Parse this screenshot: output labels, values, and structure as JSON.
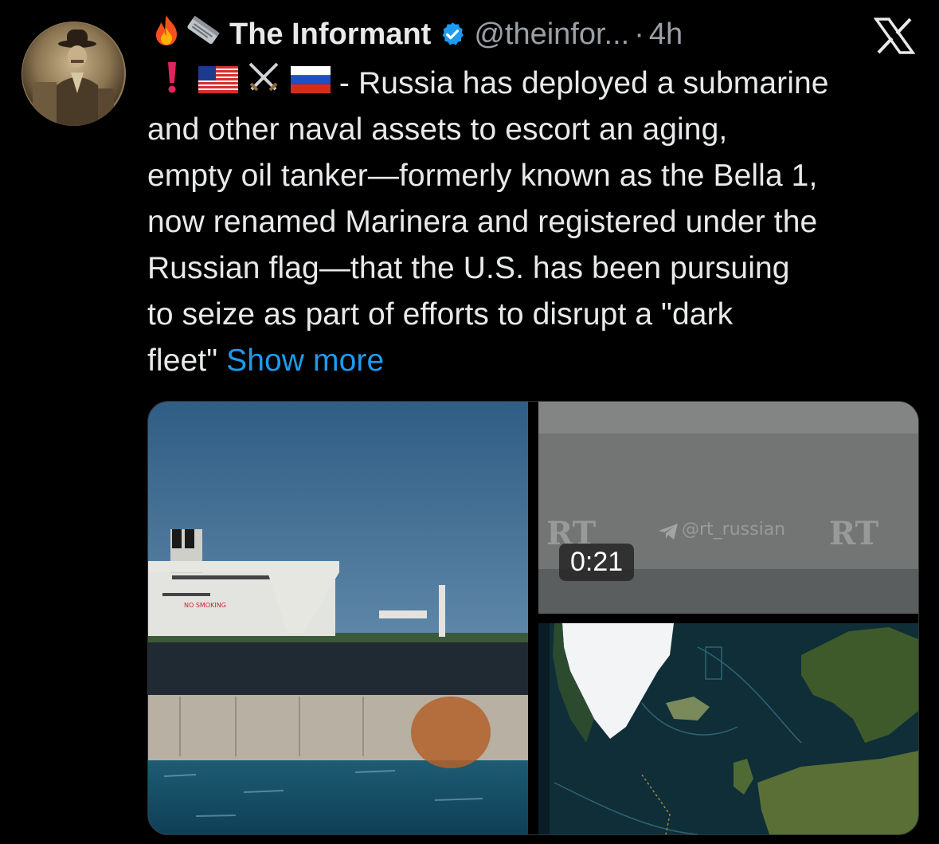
{
  "author": {
    "display_name": "The Informant",
    "handle": "@theinfor...",
    "separator": "·",
    "time": "4h",
    "emojis": [
      "fire-emoji",
      "newspaper-emoji"
    ],
    "verified_color": "#1d9bf0"
  },
  "tweet": {
    "lead_emojis": [
      "red-exclamation-emoji",
      "us-flag-emoji",
      "crossed-swords-emoji",
      "russia-flag-emoji"
    ],
    "lines": [
      " - Russia has deployed a submarine",
      "and other naval assets to escort an aging,",
      "empty oil tanker—formerly known as the Bella 1,",
      "now renamed Marinera and registered under the",
      "Russian flag—that the U.S. has been pursuing",
      "to seize as part of efforts to disrupt a \"dark",
      "fleet\""
    ],
    "show_more": "Show more"
  },
  "media": {
    "video": {
      "duration": "0:21",
      "watermark_left": "RT",
      "watermark_handle": "@rt_russian",
      "watermark_right": "RT"
    },
    "ship_markings": "NO SMOKING"
  },
  "colors": {
    "background": "#000000",
    "text": "#e7e9ea",
    "muted": "#9aa0a6",
    "link": "#1d9bf0"
  }
}
